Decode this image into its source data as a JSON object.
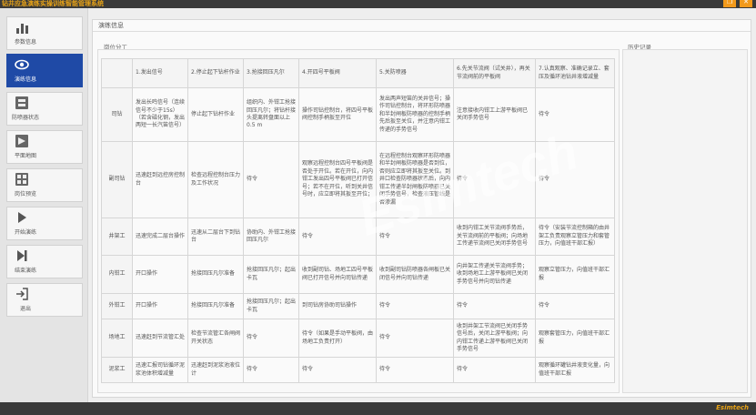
{
  "window": {
    "title": "钻井应急演练实操训练智能管理系统"
  },
  "sidebar": {
    "items": [
      {
        "label": "参数信息",
        "icon": "bar-chart-icon"
      },
      {
        "label": "演练信息",
        "icon": "eye-icon",
        "active": true
      },
      {
        "label": "防喷器状态",
        "icon": "blowout-preventer-icon"
      },
      {
        "label": "平面地图",
        "icon": "map-icon"
      },
      {
        "label": "岗位预览",
        "icon": "station-preview-icon"
      },
      {
        "label": "开始演练",
        "icon": "play-icon"
      },
      {
        "label": "结束演练",
        "icon": "skip-end-icon"
      },
      {
        "label": "退出",
        "icon": "exit-icon"
      }
    ]
  },
  "panel": {
    "title": "演练信息",
    "group_label": "岗位分工",
    "history_label": "历史记录"
  },
  "table": {
    "headers": [
      "",
      "1.发出信号",
      "2.停止起下钻杆作业",
      "3.抢接回压凡尔",
      "4.开四号平板阀",
      "5.关防喷器",
      "6.先关节流阀（试关井），再关节流阀前的平板阀",
      "7.认真观察、准确记录立、套压及循环池钻井液增减量"
    ],
    "rows": [
      {
        "role": "司钻",
        "cells": [
          "发出长鸣信号（连续信号不少于15s）（若含磁化钢，发出两短一长汽笛信号）",
          "停止起下钻杆作业",
          "组织内、外钳工抢接回压凡尔；将钻杆接头提离转盘面以上0.5 m",
          "操作司钻控制台，将四号平板阀控制手柄扳至开位",
          "发出两声短笛的关井信号；操作司钻控制台，将环形防喷器和半封闸板防喷器的控制手柄先后扳至关位，并注意内钳工传递的手势信号",
          "注意接收内钳工上游平板阀已关闭手势信号",
          "待令"
        ]
      },
      {
        "role": "副司钻",
        "cells": [
          "迅速赶到远控房控制台",
          "检查远程控制台压力及工作状况",
          "待令",
          "观察远程控制台四号平板阀是否处于开位。若在开位，向内钳工发出四号平板阀已打开信号；若不在开位，听到关井信号时，应立即将其扳至开位；",
          "在远程控制台观察环形防喷器和半封闸板防喷器是否到位，否则应立即将其扳至关位。到井口检查防喷器状态后，向内钳工传递半封闸板防喷器已关闭手势信号，检查液压管线是否渗漏",
          "待令",
          "待令"
        ]
      },
      {
        "role": "井架工",
        "cells": [
          "迅速完成二层台操作",
          "迅速从二层台下到钻台",
          "协助内、外钳工抢接回压凡尔",
          "待令",
          "待令",
          "收到内钳工关节流阀手势后，关节流阀前的平板阀；向场地工传递节流阀已关闭手势信号",
          "待令（安装节流控制箱的由井架工负责观察立管压力和套管压力，向值班干部汇报）"
        ]
      },
      {
        "role": "内钳工",
        "cells": [
          "开口操作",
          "抢接回压凡尔准备",
          "抢接回压凡尔；起出卡瓦",
          "收到副司钻、场地工四号平板阀已打开信号并向司钻传递",
          "收到副司钻防喷器各闸板已关闭信号并向司钻传递",
          "向井架工传递关节流阀手势；收到场地工上游平板阀已关闭手势信号并向司钻传递",
          "观察立管压力，向值班干部汇报"
        ]
      },
      {
        "role": "外钳工",
        "cells": [
          "开口操作",
          "抢接回压凡尔准备",
          "抢接回压凡尔；起出卡瓦",
          "到司钻房协助司钻操作",
          "待令",
          "待令",
          "待令"
        ]
      },
      {
        "role": "场地工",
        "cells": [
          "迅速赶到节流管汇处",
          "检查节流管汇各闸阀开关状态",
          "待令",
          "待令（如果是手动平板阀，由场地工负责打开）",
          "待令",
          "收到井架工节流阀已关闭手势信号后，关闭上游平板阀；向内钳工传递上游平板阀已关闭手势信号",
          "观察套管压力，向值班干部汇报"
        ]
      },
      {
        "role": "泥浆工",
        "cells": [
          "迅速汇报司钻循环泥浆池体积增减量",
          "迅速赶到泥浆池液位计",
          "待令",
          "待令",
          "待令",
          "待令",
          "观察循环罐钻井液变化量，向值班干部汇报"
        ]
      }
    ]
  },
  "footer": {
    "brand": "Esimtech"
  },
  "watermark": "Esimtech",
  "colors": {
    "accent": "#1f4aa6",
    "brand_orange": "#e8a317",
    "title_bar": "#3a3a3a"
  }
}
